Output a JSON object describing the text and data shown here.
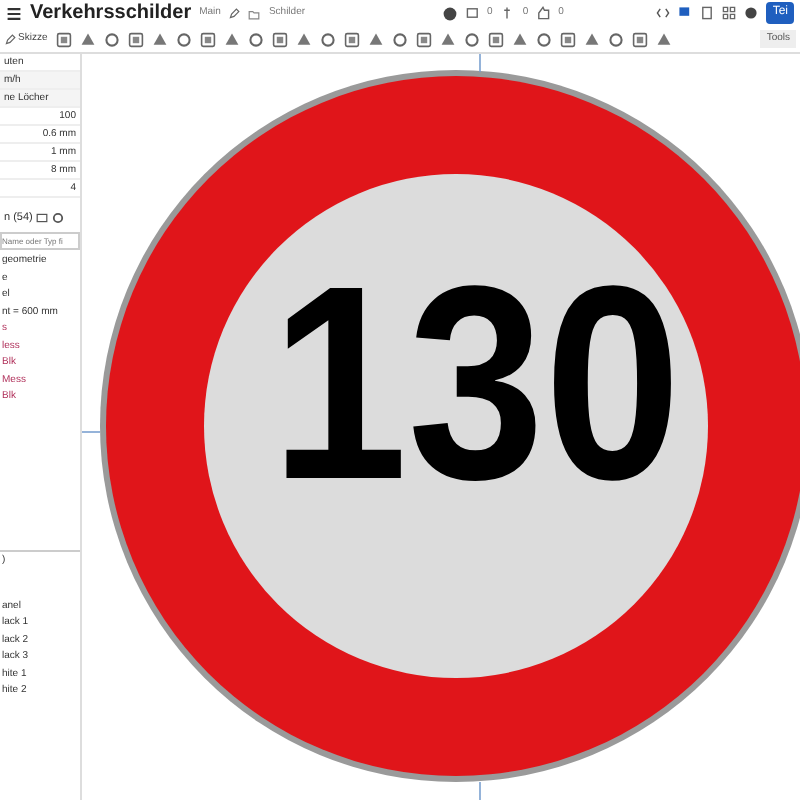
{
  "header": {
    "title": "Verkehrsschilder",
    "branch": "Main",
    "folder": "Schilder",
    "counts": [
      "0",
      "0",
      "0"
    ],
    "share_button": "Tei"
  },
  "toolbar": {
    "sketch_button": "Skizze",
    "tools_search": "Tools"
  },
  "left_panel": {
    "rows": [
      {
        "kind": "label",
        "text": "uten"
      },
      {
        "kind": "dropdown",
        "text": "m/h"
      },
      {
        "kind": "dropdown",
        "text": "ne Löcher"
      },
      {
        "kind": "value",
        "text": "100"
      },
      {
        "kind": "value",
        "text": "0.6 mm"
      },
      {
        "kind": "value",
        "text": "1 mm"
      },
      {
        "kind": "value",
        "text": "8 mm"
      },
      {
        "kind": "value",
        "text": "4"
      }
    ],
    "features_title": "n (54)",
    "filter": {
      "placeholder": "Name oder Typ fi"
    },
    "features": [
      {
        "text": "geometrie",
        "error": false
      },
      {
        "text": "e",
        "error": false
      },
      {
        "text": "el",
        "error": false
      },
      {
        "text": "nt = 600 mm",
        "error": false
      },
      {
        "text": "s",
        "error": true
      },
      {
        "text": "less",
        "error": true
      },
      {
        "text": "Blk",
        "error": true
      },
      {
        "text": "Mess",
        "error": true
      },
      {
        "text": "Blk",
        "error": true
      }
    ],
    "parts_title": ")",
    "parts": [
      "anel",
      "lack 1",
      "lack 2",
      "lack 3",
      "hite 1",
      "hite 2"
    ]
  },
  "canvas": {
    "sign_text": "130"
  }
}
